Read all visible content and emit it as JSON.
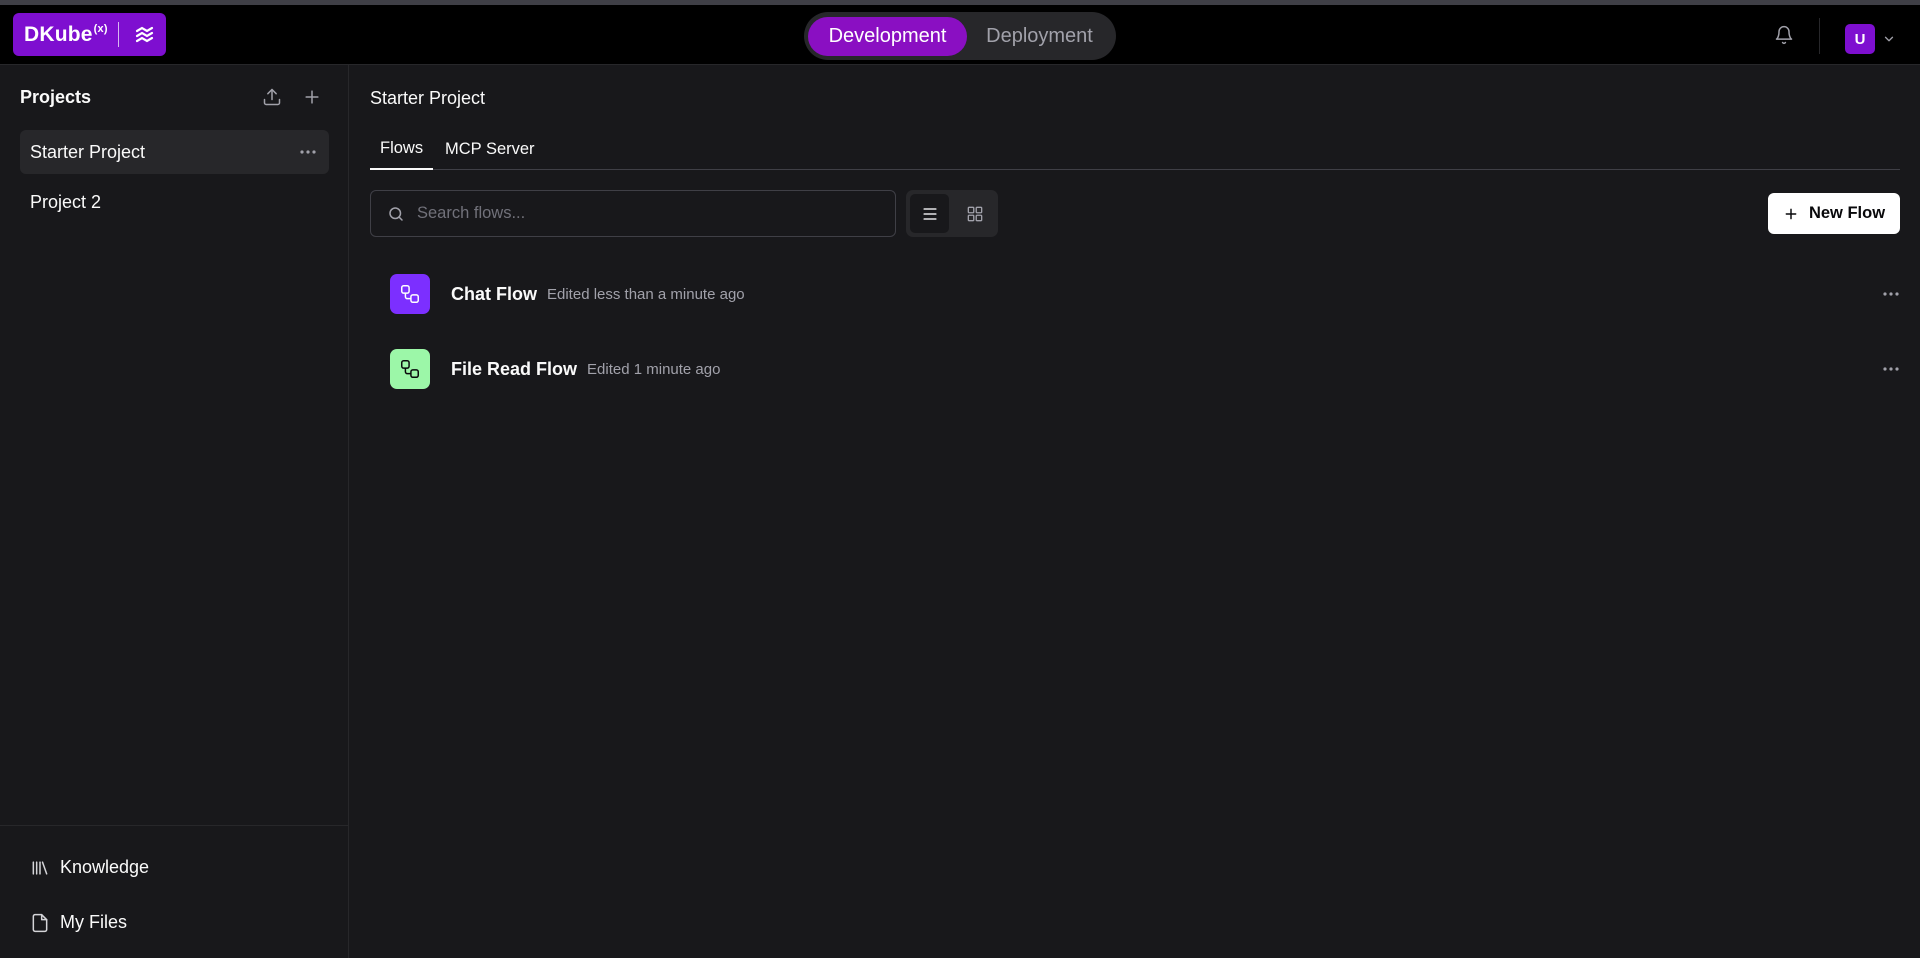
{
  "app": {
    "brand": "DKube",
    "brand_superscript": "(x)"
  },
  "header": {
    "modes": [
      {
        "label": "Development",
        "active": true
      },
      {
        "label": "Deployment",
        "active": false
      }
    ],
    "avatar_initial": "U",
    "accent_color": "#7e0fd0"
  },
  "sidebar": {
    "title": "Projects",
    "projects": [
      {
        "label": "Starter Project",
        "active": true
      },
      {
        "label": "Project 2",
        "active": false
      }
    ],
    "footer_links": [
      {
        "label": "Knowledge",
        "icon": "library-icon"
      },
      {
        "label": "My Files",
        "icon": "file-icon"
      }
    ]
  },
  "main": {
    "title": "Starter Project",
    "tabs": [
      {
        "label": "Flows",
        "active": true
      },
      {
        "label": "MCP Server",
        "active": false
      }
    ],
    "search": {
      "placeholder": "Search flows..."
    },
    "view_mode": "list",
    "new_flow_label": "New Flow",
    "flows": [
      {
        "name": "Chat Flow",
        "meta": "Edited less than a minute ago",
        "icon_color": "#7c2fff"
      },
      {
        "name": "File Read Flow",
        "meta": "Edited 1 minute ago",
        "icon_color": "#9cf7a8"
      }
    ]
  }
}
